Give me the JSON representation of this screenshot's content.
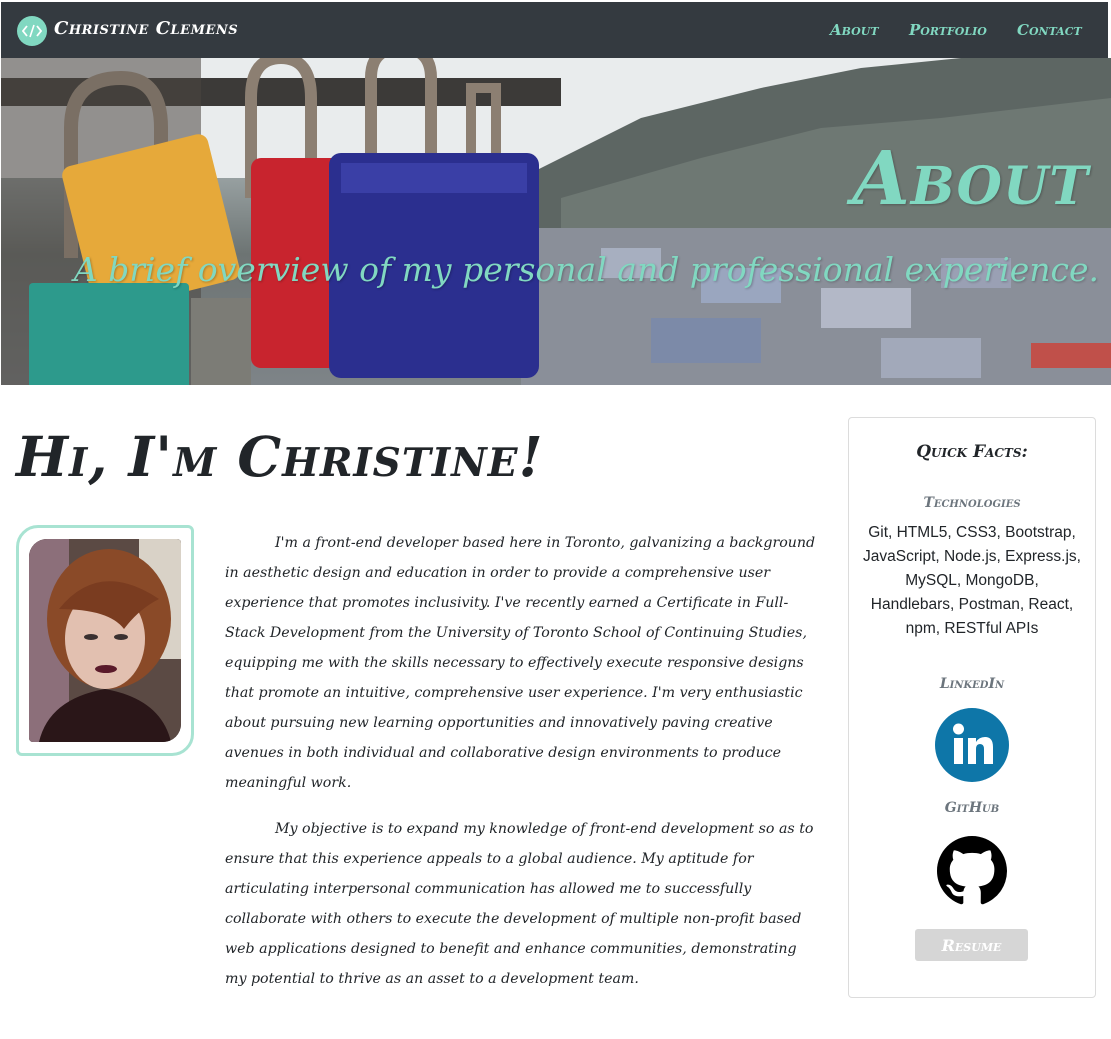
{
  "navbar": {
    "brand_name": "Christine Clemens",
    "brand_icon": "code-icon",
    "links": [
      "About",
      "Portfolio",
      "Contact"
    ]
  },
  "hero": {
    "title": "About",
    "subtitle": "A brief overview of my personal and professional experience."
  },
  "main": {
    "greeting": "Hi, I'm Christine!",
    "bio_paragraphs": [
      "I'm a front-end developer based here in Toronto, galvanizing a background in aesthetic design and education in order to provide a comprehensive user experience that promotes inclusivity. I've recently earned a Certificate in Full-Stack Development from the University of Toronto School of Continuing Studies, equipping me with the skills necessary to effectively execute responsive designs that promote an intuitive, comprehensive user experience. I'm very enthusiastic about pursuing new learning opportunities and innovatively paving creative avenues in both individual and collaborative design environments to produce meaningful work.",
      "My objective is to expand my knowledge of front-end development so as to ensure that this experience appeals to a global audience. My aptitude for articulating interpersonal communication has allowed me to successfully collaborate with others to execute the development of multiple non-profit based web applications designed to benefit and enhance communities, demonstrating my potential to thrive as an asset to a development team."
    ]
  },
  "sidebar": {
    "title": "Quick Facts:",
    "technologies_heading": "Technologies",
    "technologies": "Git, HTML5, CSS3, Bootstrap, JavaScript, Node.js, Express.js, MySQL, MongoDB, Handlebars, Postman, React, npm, RESTful APIs",
    "linkedin_heading": "LinkedIn",
    "linkedin_icon": "linkedin-icon",
    "github_heading": "GitHub",
    "github_icon": "github-icon",
    "resume_label": "Resume"
  },
  "colors": {
    "accent": "#81d8c1",
    "navbar": "#343a40",
    "linkedin": "#0e76a8"
  }
}
